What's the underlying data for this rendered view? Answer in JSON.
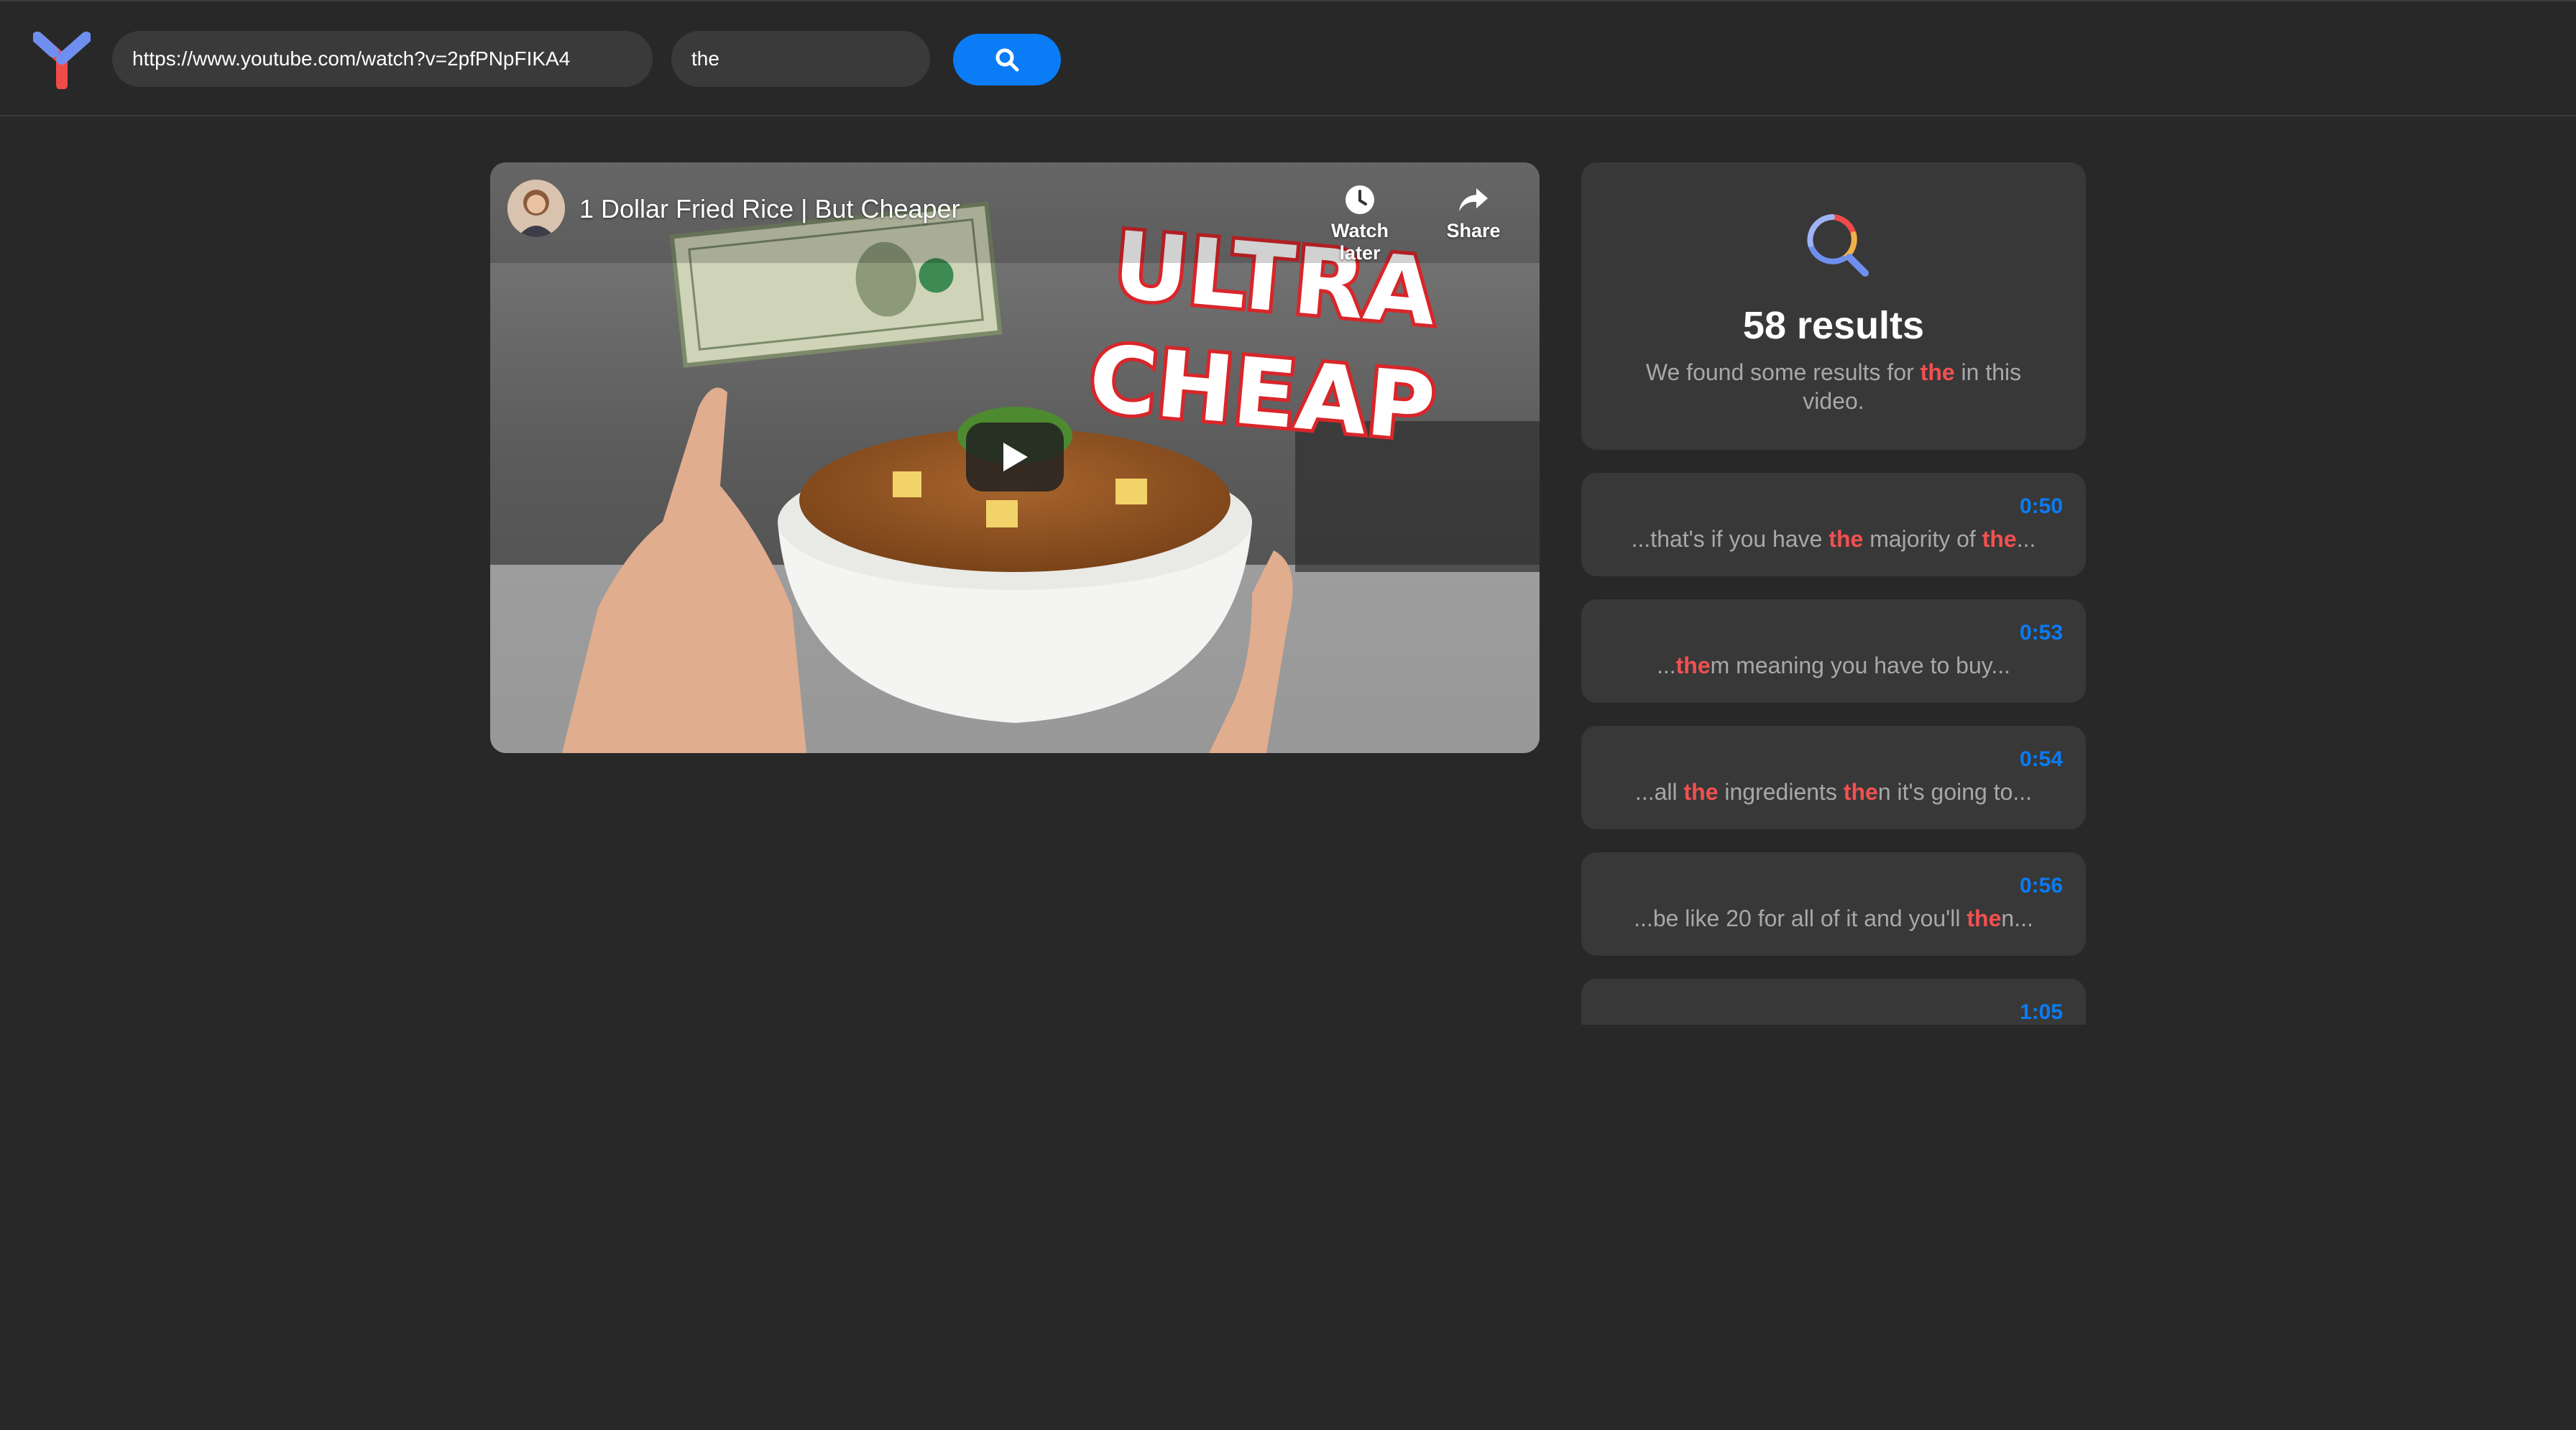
{
  "header": {
    "logo_icon": "app-logo-y-icon",
    "url_value": "https://www.youtube.com/watch?v=2pfPNpFIKA4",
    "search_term": "the",
    "search_button_icon": "search-icon",
    "accent_color": "#0a7cf5"
  },
  "video": {
    "title": "1 Dollar Fried Rice | But Cheaper",
    "watch_later_label": "Watch later",
    "share_label": "Share",
    "thumbnail_text_line1": "ULTRA",
    "thumbnail_text_line2": "CHEAP"
  },
  "summary": {
    "count_label": "58 results",
    "desc_prefix": "We found some results for ",
    "desc_term": "the",
    "desc_suffix": " in this video."
  },
  "results": [
    {
      "time": "0:50",
      "parts": [
        {
          "t": "...that's if you have ",
          "h": false
        },
        {
          "t": "the",
          "h": true
        },
        {
          "t": " majority of ",
          "h": false
        },
        {
          "t": "the",
          "h": true
        },
        {
          "t": "...",
          "h": false
        }
      ]
    },
    {
      "time": "0:53",
      "parts": [
        {
          "t": "...",
          "h": false
        },
        {
          "t": "the",
          "h": true
        },
        {
          "t": "m meaning you have to buy...",
          "h": false
        }
      ]
    },
    {
      "time": "0:54",
      "parts": [
        {
          "t": "...all ",
          "h": false
        },
        {
          "t": "the",
          "h": true
        },
        {
          "t": " ingredients ",
          "h": false
        },
        {
          "t": "the",
          "h": true
        },
        {
          "t": "n it's going to...",
          "h": false
        }
      ]
    },
    {
      "time": "0:56",
      "parts": [
        {
          "t": "...be like 20 for all of it and you'll ",
          "h": false
        },
        {
          "t": "the",
          "h": true
        },
        {
          "t": "n...",
          "h": false
        }
      ]
    },
    {
      "time": "1:05",
      "parts": []
    }
  ],
  "colors": {
    "background": "#282828",
    "card": "#383838",
    "highlight": "#f25050",
    "timestamp": "#0a7cf5"
  }
}
